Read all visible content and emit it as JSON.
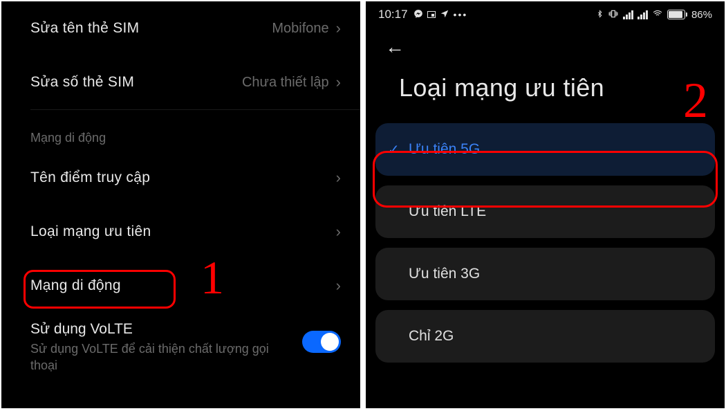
{
  "left": {
    "rows": [
      {
        "label": "Sửa tên thẻ SIM",
        "value": "Mobifone"
      },
      {
        "label": "Sửa số thẻ SIM",
        "value": "Chưa thiết lập"
      }
    ],
    "section_header": "Mạng di động",
    "items": [
      {
        "label": "Tên điểm truy cập"
      },
      {
        "label": "Loại mạng ưu tiên"
      },
      {
        "label": "Mạng di động"
      }
    ],
    "volte": {
      "title": "Sử dụng VoLTE",
      "subtitle": "Sử dụng VoLTE để cải thiện chất lượng gọi thoại",
      "on": true
    },
    "annotation_number": "1"
  },
  "right": {
    "status": {
      "time": "10:17",
      "battery_pct": "86%"
    },
    "title": "Loại mạng ưu tiên",
    "options": [
      {
        "label": "Ưu tiên 5G",
        "selected": true
      },
      {
        "label": "Ưu tiên LTE",
        "selected": false
      },
      {
        "label": "Ưu tiên 3G",
        "selected": false
      },
      {
        "label": "Chỉ 2G",
        "selected": false
      }
    ],
    "annotation_number": "2"
  }
}
